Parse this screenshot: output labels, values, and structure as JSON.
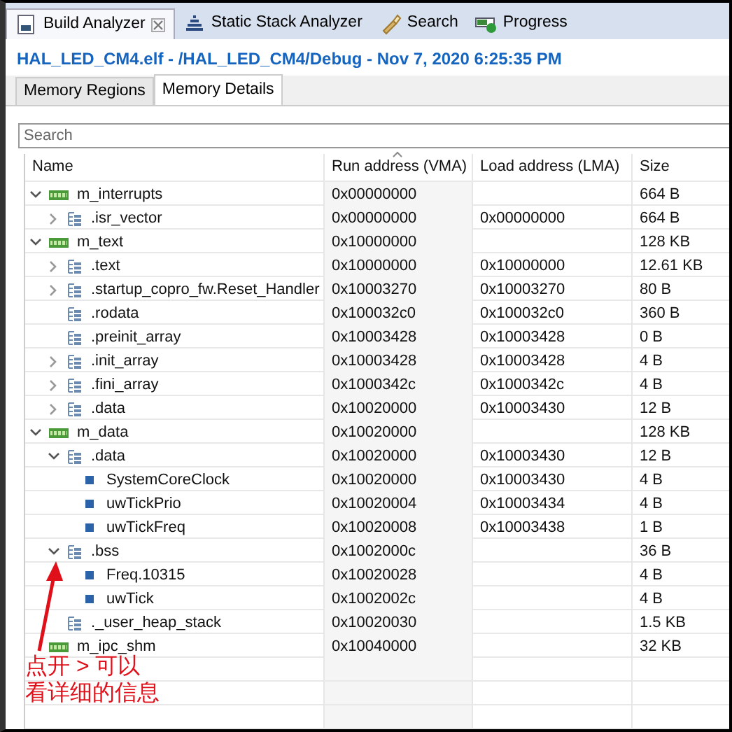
{
  "view_tabs": [
    {
      "label": "Build Analyzer",
      "selected": true,
      "closable": true
    },
    {
      "label": "Static Stack Analyzer",
      "selected": false
    },
    {
      "label": "Search",
      "selected": false
    },
    {
      "label": "Progress",
      "selected": false
    }
  ],
  "file_title": "HAL_LED_CM4.elf - /HAL_LED_CM4/Debug - Nov 7, 2020 6:25:35 PM",
  "sub_tabs": [
    {
      "label": "Memory Regions",
      "selected": false
    },
    {
      "label": "Memory Details",
      "selected": true
    }
  ],
  "search": {
    "placeholder": "Search"
  },
  "table": {
    "columns": [
      {
        "label": "Name",
        "sorted": false
      },
      {
        "label": "Run address (VMA)",
        "sorted": true
      },
      {
        "label": "Load address (LMA)",
        "sorted": false
      },
      {
        "label": "Size",
        "sorted": false
      }
    ],
    "rows": [
      {
        "kind": "region",
        "name": "m_interrupts",
        "vma": "0x00000000",
        "size": "664 B",
        "expanded": true,
        "children": [
          {
            "kind": "section",
            "name": ".isr_vector",
            "vma": "0x00000000",
            "lma": "0x00000000",
            "size": "664 B",
            "expanded": false
          }
        ]
      },
      {
        "kind": "region",
        "name": "m_text",
        "vma": "0x10000000",
        "size": "128 KB",
        "expanded": true,
        "children": [
          {
            "kind": "section",
            "name": ".text",
            "vma": "0x10000000",
            "lma": "0x10000000",
            "size": "12.61 KB",
            "expanded": false
          },
          {
            "kind": "section",
            "name": ".startup_copro_fw.Reset_Handler",
            "vma": "0x10003270",
            "lma": "0x10003270",
            "size": "80 B",
            "expanded": false
          },
          {
            "kind": "section",
            "name": ".rodata",
            "vma": "0x100032c0",
            "lma": "0x100032c0",
            "size": "360 B"
          },
          {
            "kind": "section",
            "name": ".preinit_array",
            "vma": "0x10003428",
            "lma": "0x10003428",
            "size": "0 B"
          },
          {
            "kind": "section",
            "name": ".init_array",
            "vma": "0x10003428",
            "lma": "0x10003428",
            "size": "4 B",
            "expanded": false
          },
          {
            "kind": "section",
            "name": ".fini_array",
            "vma": "0x1000342c",
            "lma": "0x1000342c",
            "size": "4 B",
            "expanded": false
          },
          {
            "kind": "section",
            "name": ".data",
            "vma": "0x10020000",
            "lma": "0x10003430",
            "size": "12 B",
            "expanded": false
          }
        ]
      },
      {
        "kind": "region",
        "name": "m_data",
        "vma": "0x10020000",
        "size": "128 KB",
        "expanded": true,
        "children": [
          {
            "kind": "section",
            "name": ".data",
            "vma": "0x10020000",
            "lma": "0x10003430",
            "size": "12 B",
            "expanded": true,
            "children": [
              {
                "kind": "symbol",
                "name": "SystemCoreClock",
                "vma": "0x10020000",
                "lma": "0x10003430",
                "size": "4 B"
              },
              {
                "kind": "symbol",
                "name": "uwTickPrio",
                "vma": "0x10020004",
                "lma": "0x10003434",
                "size": "4 B"
              },
              {
                "kind": "symbol",
                "name": "uwTickFreq",
                "vma": "0x10020008",
                "lma": "0x10003438",
                "size": "1 B"
              }
            ]
          },
          {
            "kind": "section",
            "name": ".bss",
            "vma": "0x1002000c",
            "size": "36 B",
            "expanded": true,
            "children": [
              {
                "kind": "symbol",
                "name": "Freq.10315",
                "vma": "0x10020028",
                "size": "4 B"
              },
              {
                "kind": "symbol",
                "name": "uwTick",
                "vma": "0x1002002c",
                "size": "4 B"
              }
            ]
          },
          {
            "kind": "section",
            "name": "._user_heap_stack",
            "vma": "0x10020030",
            "size": "1.5 KB"
          }
        ]
      },
      {
        "kind": "region",
        "name": "m_ipc_shm",
        "vma": "0x10040000",
        "size": "32 KB"
      }
    ]
  },
  "annotation": {
    "lines": [
      "点开 > 可以",
      "看详细的信息"
    ]
  }
}
